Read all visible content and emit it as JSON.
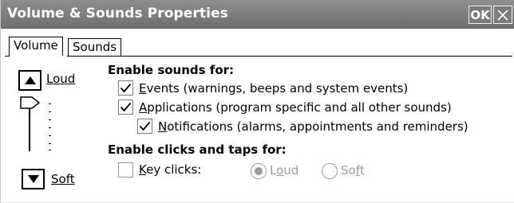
{
  "window": {
    "title": "Volume & Sounds Properties",
    "ok_label": "OK",
    "close_icon": "close-icon"
  },
  "tabs": [
    {
      "label": "Volume",
      "selected": true
    },
    {
      "label": "Sounds",
      "selected": false
    }
  ],
  "volume": {
    "loud_label": "Loud",
    "soft_label": "Soft",
    "level_fraction": 1.0
  },
  "sounds_section": {
    "heading": "Enable sounds for:",
    "events": {
      "mnemonic": "E",
      "rest": "vents (warnings, beeps and system events)",
      "checked": true
    },
    "applications": {
      "mnemonic": "A",
      "rest": "pplications (program specific and all other sounds)",
      "checked": true
    },
    "notifications": {
      "mnemonic": "N",
      "rest": "otifications (alarms, appointments and reminders)",
      "checked": true
    }
  },
  "clicks_section": {
    "heading": "Enable clicks and taps for:",
    "key_clicks": {
      "mnemonic": "K",
      "rest": "ey clicks:",
      "checked": false
    },
    "loud": {
      "pre": "L",
      "mnemonic": "o",
      "post": "ud",
      "selected": true,
      "enabled": false
    },
    "soft": {
      "pre": "So",
      "mnemonic": "f",
      "post": "t",
      "selected": false,
      "enabled": false
    }
  },
  "colors": {
    "titlebar": "#7c7c7c",
    "disabled": "#9a9a9a"
  }
}
